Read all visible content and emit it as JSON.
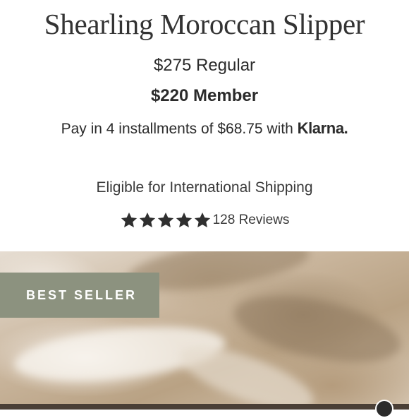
{
  "product": {
    "title": "Shearling Moroccan Slipper",
    "price_regular": "$275 Regular",
    "price_member": "$220 Member",
    "installments_text": "Pay in 4 installments of $68.75 with",
    "installments_provider": "Klarna.",
    "shipping_text": "Eligible for International Shipping",
    "rating": {
      "stars": 5,
      "max_stars": 5,
      "review_count_label": "128 Reviews"
    }
  },
  "hero": {
    "badge_label": "BEST SELLER"
  },
  "colors": {
    "badge_bg": "#8c927f",
    "text": "#2b2b2b",
    "star": "#2f2f2f"
  },
  "icons": {
    "star": "star-icon"
  }
}
